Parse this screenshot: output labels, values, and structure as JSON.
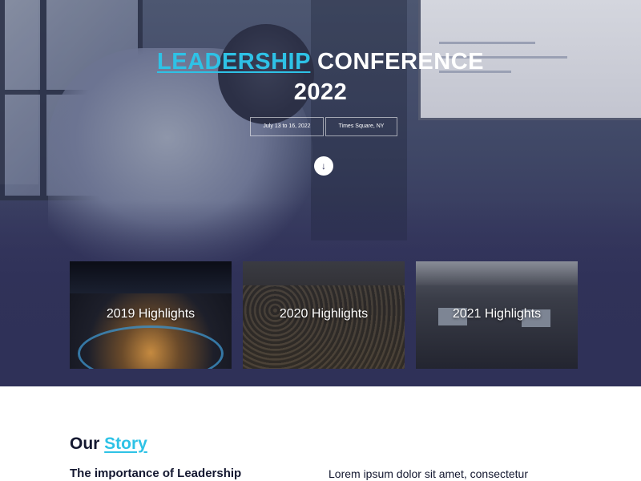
{
  "hero": {
    "title_accent": "LEADERSHIP",
    "title_rest": " CONFERENCE",
    "title_year": "2022",
    "date_chip": "July 13 to 16, 2022",
    "location_chip": "Times Square, NY",
    "scroll_icon": "arrow-down-icon",
    "scroll_glyph": "↓",
    "accent_color": "#2ec2e6"
  },
  "highlights": [
    {
      "label": "2019 Highlights"
    },
    {
      "label": "2020 Highlights"
    },
    {
      "label": "2021 Highlights"
    }
  ],
  "story": {
    "heading_plain": "Our ",
    "heading_accent": "Story",
    "subheading": "The importance of Leadership",
    "paragraph": "Lorem ipsum dolor sit amet, consectetur"
  }
}
